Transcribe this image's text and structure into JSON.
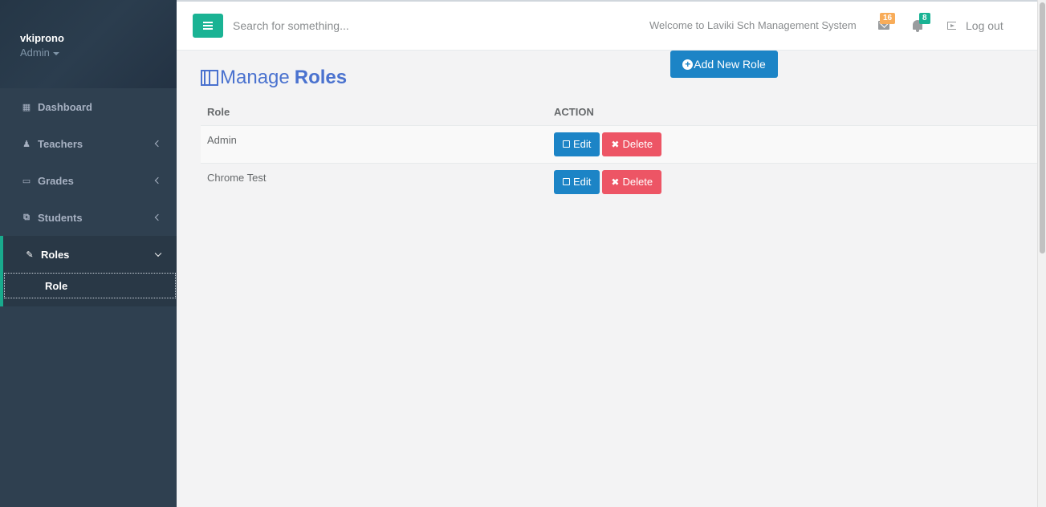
{
  "sidebar": {
    "user_name": "vkiprono",
    "user_role": "Admin",
    "items": [
      {
        "label": "Dashboard",
        "icon": "dashboard-icon"
      },
      {
        "label": "Teachers",
        "icon": "user-icon"
      },
      {
        "label": "Grades",
        "icon": "desktop-icon"
      },
      {
        "label": "Students",
        "icon": "copy-icon"
      },
      {
        "label": "Roles",
        "icon": "edit-icon"
      }
    ],
    "subitems": [
      {
        "label": "Role"
      }
    ]
  },
  "topbar": {
    "search_placeholder": "Search for something...",
    "welcome": "Welcome to Laviki Sch Management System",
    "messages_count": "16",
    "notifications_count": "8",
    "logout_label": "Log out"
  },
  "main": {
    "add_button": "Add New Role",
    "title_light": "Manage",
    "title_bold": "Roles",
    "columns": [
      "Role",
      "ACTION"
    ],
    "rows": [
      {
        "role": "Admin",
        "edit": "Edit",
        "delete": "Delete"
      },
      {
        "role": "Chrome Test",
        "edit": "Edit",
        "delete": "Delete"
      }
    ]
  },
  "colors": {
    "sidebar_bg": "#2f4050",
    "accent_green": "#1ab394",
    "primary_blue": "#1c84c6",
    "danger_red": "#ed5565",
    "title_blue": "#4a72cf"
  }
}
